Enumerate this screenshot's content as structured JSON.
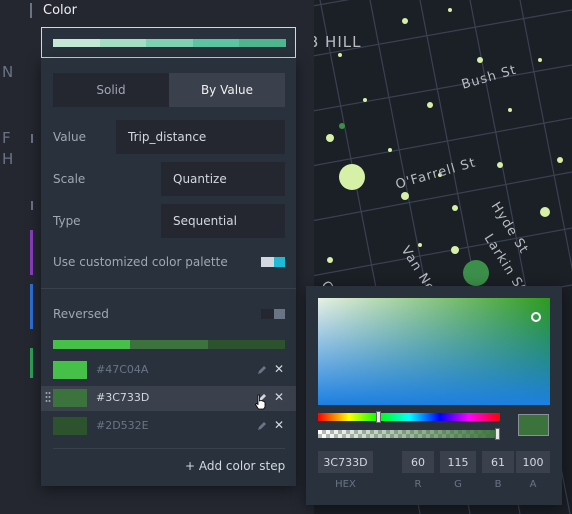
{
  "map": {
    "labels": [
      "B HILL",
      "Bush St",
      "O'Farrell St",
      "Hyde St",
      "Larkin St",
      "Van Ne",
      "Go",
      "F",
      "H",
      "N"
    ]
  },
  "panel": {
    "section_title": "Color",
    "preview_colors": [
      "#c5e8d6",
      "#a2ddc4",
      "#7fd1b2",
      "#5cc4a0",
      "#4fb58f"
    ],
    "dropdown": {
      "mode_options": [
        "Solid",
        "By Value"
      ],
      "mode_selected": "By Value",
      "value_label": "Value",
      "value_field": "Trip_distance",
      "scale_label": "Scale",
      "scale_value": "Quantize",
      "type_label": "Type",
      "type_value": "Sequential",
      "custom_palette_label": "Use customized color palette",
      "custom_palette_on": true,
      "reversed_label": "Reversed",
      "reversed_on": false,
      "steps": [
        {
          "hex": "#47C04A",
          "color": "#47c04a"
        },
        {
          "hex": "#3C733D",
          "color": "#3c733d"
        },
        {
          "hex": "#2D532E",
          "color": "#2d532e"
        }
      ],
      "hovered_step": 1,
      "add_step_label": "+ Add color step"
    }
  },
  "picker": {
    "hex": "3C733D",
    "r": "60",
    "g": "115",
    "b": "61",
    "a": "100",
    "hex_label": "HEX",
    "r_label": "R",
    "g_label": "G",
    "b_label": "B",
    "a_label": "A",
    "current_color": "#3c733d",
    "hue_level": 0.33,
    "alpha_level": 1.0
  },
  "colors": {
    "accent": "#1fbad6",
    "panel_bg": "#242730",
    "dropdown_bg": "#29323c"
  }
}
